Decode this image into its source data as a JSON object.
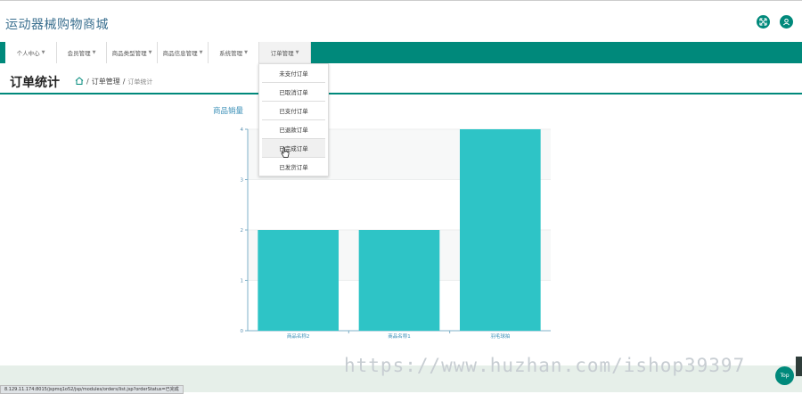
{
  "app": {
    "title": "运动器械购物商城"
  },
  "nav": {
    "items": [
      {
        "label": "个人中心"
      },
      {
        "label": "会员管理"
      },
      {
        "label": "商品类型管理"
      },
      {
        "label": "商品信息管理"
      },
      {
        "label": "系统管理"
      },
      {
        "label": "订单管理"
      }
    ]
  },
  "page": {
    "title": "订单统计",
    "breadcrumb": [
      "订单管理",
      "订单统计"
    ]
  },
  "order_menu": {
    "items": [
      "未支付订单",
      "已取消订单",
      "已支付订单",
      "已退款订单",
      "已完成订单",
      "已发货订单"
    ],
    "hovered_index": 4
  },
  "chart_data": {
    "type": "bar",
    "title": "商品销量",
    "categories": [
      "商品名称2",
      "商品名称1",
      "羽毛球拍"
    ],
    "values": [
      2,
      2,
      4
    ],
    "ylim": [
      0,
      4
    ],
    "yticks": [
      0,
      1,
      2,
      3,
      4
    ],
    "grid": true,
    "bar_color": "#2ec4c6"
  },
  "status_bar": {
    "url": "8.129.11.174:8015/jspmq1o52/jsp/modules/orders/list.jsp?orderStatus=已完成"
  },
  "watermark": "https://www.huzhan.com/ishop39397",
  "top_button": {
    "label": "Top"
  },
  "colors": {
    "accent": "#00897b"
  }
}
